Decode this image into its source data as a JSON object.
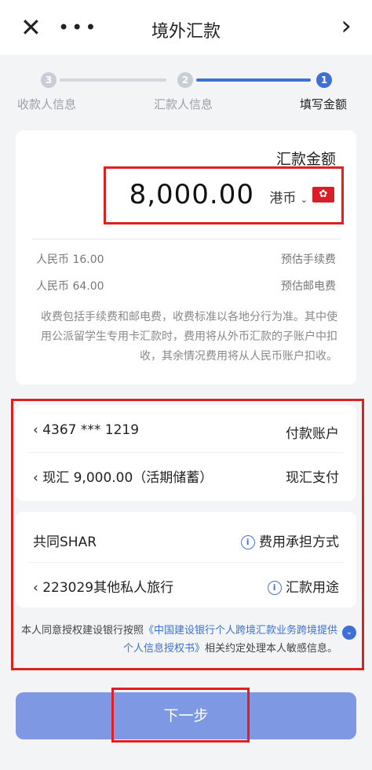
{
  "header": {
    "close_icon": "close-icon",
    "more_icon": "more-icon",
    "title": "境外汇款",
    "back_icon": "chevron-left-icon"
  },
  "steps": [
    {
      "number": "1",
      "label": "填写金额",
      "state": "active"
    },
    {
      "number": "2",
      "label": "汇款人信息",
      "state": "pending"
    },
    {
      "number": "3",
      "label": "收款人信息",
      "state": "pending"
    }
  ],
  "amount_card": {
    "title": "汇款金额",
    "currency": "港币",
    "currency_flag": "hk-flag-icon",
    "amount": "8,000.00",
    "fees": [
      {
        "label": "预估手续费",
        "value": "人民币 16.00"
      },
      {
        "label": "预估邮电费",
        "value": "人民币 64.00"
      }
    ],
    "note": "收费包括手续费和邮电费，收费标准以各地分行为准。其中使用公派留学生专用卡汇款时，费用将从外币汇款的子账户中扣收，其余情况费用将从人民币账户扣收。"
  },
  "payment": {
    "account_label": "付款账户",
    "account_value": "4367 *** 1219",
    "cash_label": "现汇支付",
    "cash_value": "现汇 9,000.00（活期储蓄）",
    "fee_bearer_label": "费用承担方式",
    "fee_bearer_value": "共同SHAR",
    "purpose_label": "汇款用途",
    "purpose_value": "223029其他私人旅行"
  },
  "consent": {
    "prefix": "本人同意授权建设银行按照",
    "link1": "《中国建设银行个人跨境汇款业务跨境提供个人信息授权书》",
    "suffix": "相关约定处理本人敏感信息。"
  },
  "next_button": "下一步",
  "colors": {
    "accent": "#3f6fd4",
    "button": "#7e98e4",
    "highlight": "#e02020",
    "flag": "#d91e2a"
  }
}
